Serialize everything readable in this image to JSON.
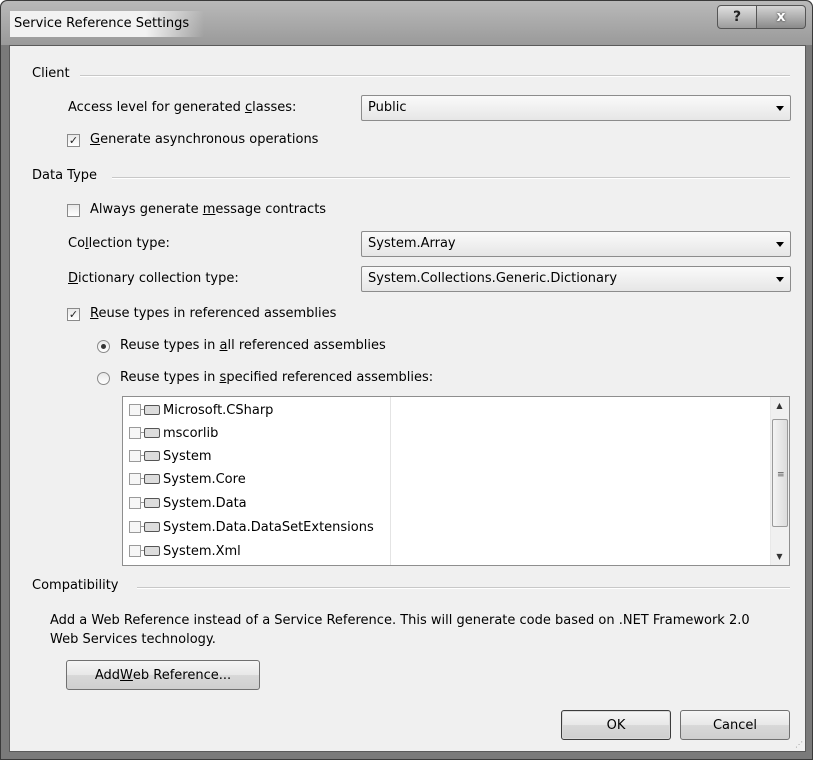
{
  "window": {
    "title": "Service Reference Settings",
    "help_label": "?",
    "close_label": "x"
  },
  "client_group": {
    "label": "Client",
    "access_level_label_pre": "Access level for generated ",
    "access_level_label_key": "c",
    "access_level_label_post": "lasses:",
    "access_level_value": "Public",
    "generate_async_key": "G",
    "generate_async_rest": "enerate asynchronous operations",
    "generate_async_checked": true
  },
  "data_type_group": {
    "label": "Data Type",
    "always_generate_pre": "Always generate ",
    "always_generate_key": "m",
    "always_generate_post": "essage contracts",
    "always_generate_checked": false,
    "collection_type_pre": "Co",
    "collection_type_key": "l",
    "collection_type_post": "lection type:",
    "collection_type_value": "System.Array",
    "dictionary_type_key": "D",
    "dictionary_type_rest": "ictionary collection type:",
    "dictionary_type_value": "System.Collections.Generic.Dictionary",
    "reuse_types_key": "R",
    "reuse_types_rest": "euse types in referenced assemblies",
    "reuse_types_checked": true,
    "reuse_all_pre": "Reuse types in ",
    "reuse_all_key": "a",
    "reuse_all_post": "ll referenced assemblies",
    "reuse_all_selected": true,
    "reuse_specified_pre": "Reuse types in ",
    "reuse_specified_key": "s",
    "reuse_specified_post": "pecified referenced assemblies:",
    "reuse_specified_selected": false,
    "assemblies": [
      {
        "name": "Microsoft.CSharp",
        "checked": false
      },
      {
        "name": "mscorlib",
        "checked": false
      },
      {
        "name": "System",
        "checked": false
      },
      {
        "name": "System.Core",
        "checked": false
      },
      {
        "name": "System.Data",
        "checked": false
      },
      {
        "name": "System.Data.DataSetExtensions",
        "checked": false
      },
      {
        "name": "System.Xml",
        "checked": false
      }
    ]
  },
  "compatibility_group": {
    "label": "Compatibility",
    "description_line1": "Add a Web Reference instead of a Service Reference. This will generate code based on .NET Framework 2.0",
    "description_line2": "Web Services technology.",
    "add_web_ref_pre": "Add ",
    "add_web_ref_key": "W",
    "add_web_ref_post": "eb Reference..."
  },
  "buttons": {
    "ok": "OK",
    "cancel": "Cancel"
  }
}
